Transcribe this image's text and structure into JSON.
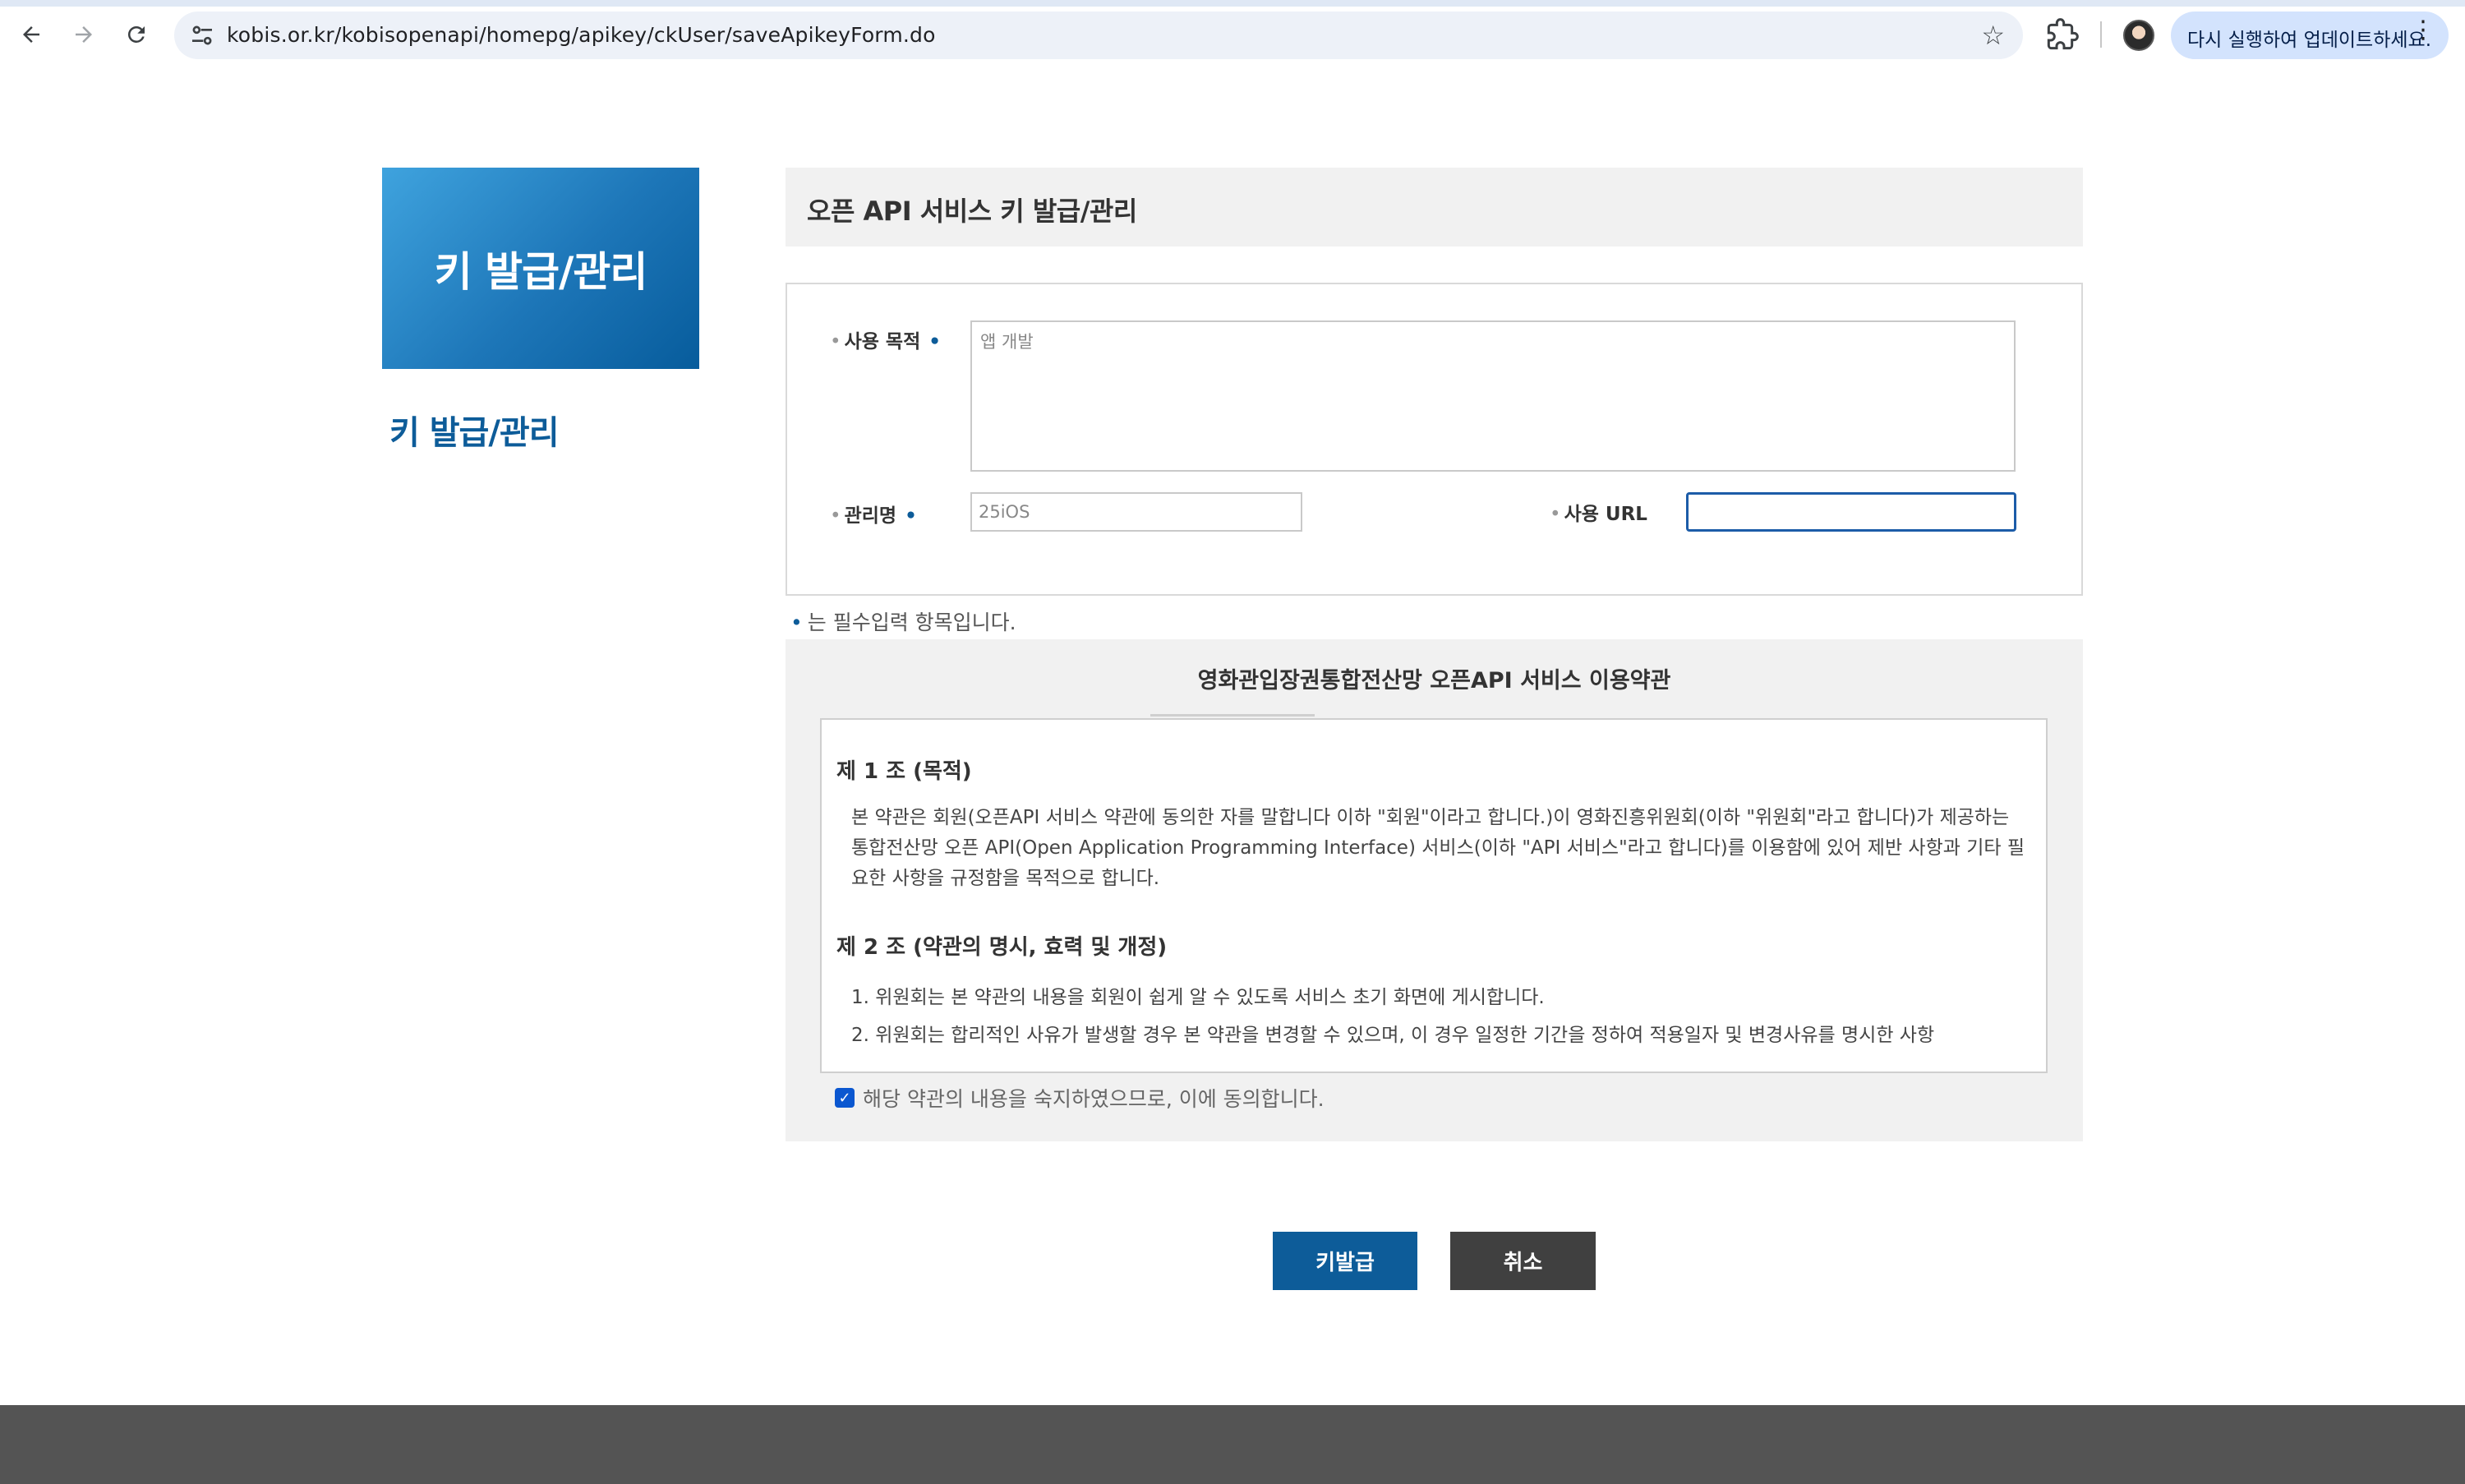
{
  "browser": {
    "url": "kobis.or.kr/kobisopenapi/homepg/apikey/ckUser/saveApikeyForm.do",
    "update_label": "다시 실행하여 업데이트하세요."
  },
  "sidebar": {
    "banner_title": "키 발급/관리",
    "nav_title": "키 발급/관리"
  },
  "main": {
    "header_title": "오픈 API 서비스 키 발급/관리"
  },
  "form": {
    "purpose_label": "사용 목적",
    "purpose_value": "앱 개발",
    "name_label": "관리명",
    "name_value": "25iOS",
    "url_label": "사용 URL",
    "url_value": "",
    "required_note": "는 필수입력 항목입니다."
  },
  "terms": {
    "title": "영화관입장권통합전산망 오픈API 서비스 이용약관",
    "article1_title": "제 1 조 (목적)",
    "article1_body": "본 약관은 회원(오픈API 서비스 약관에 동의한 자를 말합니다 이하 \"회원\"이라고 합니다.)이 영화진흥위원회(이하 \"위원회\"라고 합니다)가 제공하는 통합전산망 오픈 API(Open Application Programming Interface) 서비스(이하 \"API 서비스\"라고 합니다)를 이용함에 있어 제반 사항과 기타 필요한 사항을 규정함을 목적으로 합니다.",
    "article2_title": "제 2 조 (약관의 명시, 효력 및 개정)",
    "article2_items": [
      "1. 위원회는 본 약관의 내용을 회원이 쉽게 알 수 있도록 서비스 초기 화면에 게시합니다.",
      "2. 위원회는 합리적인 사유가 발생할 경우 본 약관을 변경할 수 있으며, 이 경우 일정한 기간을 정하여 적용일자 및 변경사유를 명시한 사항"
    ],
    "agree_label": "해당 약관의 내용을 숙지하였으므로, 이에 동의합니다.",
    "agree_checked": true
  },
  "buttons": {
    "issue": "키발급",
    "cancel": "취소"
  }
}
